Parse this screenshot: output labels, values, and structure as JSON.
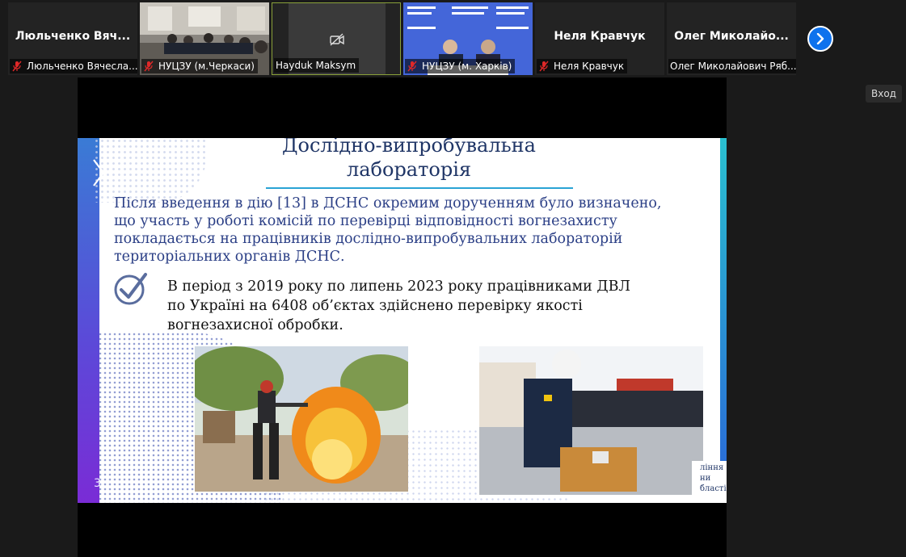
{
  "participants": [
    {
      "display_name": "Люльченко  Вяч...",
      "caption": "Люльченко Вячесла...",
      "muted": true,
      "video": false
    },
    {
      "display_name": "",
      "caption": "НУЦЗУ (м.Черкаси)",
      "muted": true,
      "video": true
    },
    {
      "display_name": "",
      "caption": "Hayduk Maksym",
      "muted": false,
      "video": false,
      "camera_off": true,
      "active": true
    },
    {
      "display_name": "",
      "caption": "НУЦЗУ (м. Харків)",
      "muted": true,
      "video": true
    },
    {
      "display_name": "Неля Кравчук",
      "caption": "Неля Кравчук",
      "muted": true,
      "video": false
    },
    {
      "display_name": "Олег  Миколайо...",
      "caption": "Олег Миколайович Ряб...",
      "muted": false,
      "video": false
    }
  ],
  "controls": {
    "next_icon": "chevron-right-icon",
    "vhod_label": "Вход"
  },
  "slide": {
    "title_line1": "Дослідно-випробувальна",
    "title_line2": "лабораторія",
    "paragraph": "Після введення в дію [13] в ДСНС окремим дорученням було визначено, що участь у роботі комісій по перевірці відповідності вогнезахисту покладається на працівників дослідно-випробувальних лабораторій територіальних органів ДСНС.",
    "bullet": "В період з 2019 року по липень 2023 року працівниками ДВЛ по Україні на 6408 об’єктах здійснено перевірку якості вогнезахисної обробки.",
    "page_number": "3",
    "logo_text_lines": [
      "ління",
      "ни",
      "бласті"
    ]
  },
  "colors": {
    "accent": "#0e72ed",
    "active_border": "#8aa13a",
    "slide_title": "#1f3566",
    "slide_text": "#2b3f86",
    "muted_mic": "#e02828"
  }
}
